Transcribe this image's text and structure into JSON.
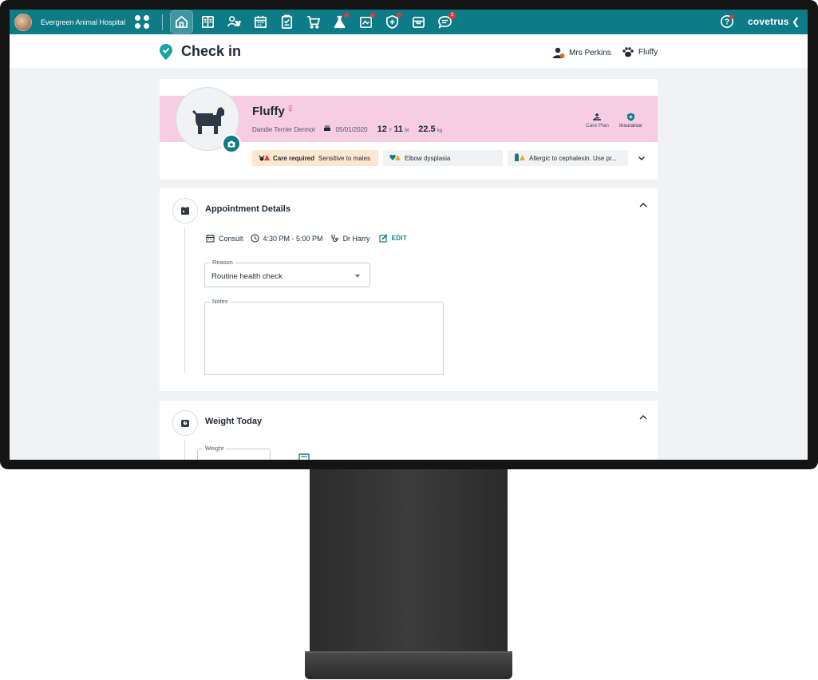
{
  "nav": {
    "hospital_name": "Evergreen Animal Hospital",
    "brand": "covetrus",
    "messages_count": "3"
  },
  "header": {
    "title": "Check in",
    "owner_name": "Mrs Perkins",
    "pet_name": "Fluffy"
  },
  "pet": {
    "name": "Fluffy",
    "sex_symbol": "♀",
    "breed": "Dandie Terrier Dermot",
    "dob": "05/01/2020",
    "age_years": "12",
    "age_years_unit": "Y",
    "age_months": "11",
    "age_months_unit": "M",
    "weight": "22.5",
    "weight_unit": "kg",
    "care_plan_label": "Care Plan",
    "insurance_label": "Insurance",
    "alerts": {
      "care_title": "Care required",
      "care_text": "Sensitive to males",
      "condition": "Elbow dysplasia",
      "allergy": "Allergic to cephalexin. Use pr..."
    }
  },
  "appointment": {
    "title": "Appointment Details",
    "type": "Consult",
    "time": "4:30 PM - 5:00 PM",
    "vet": "Dr Harry",
    "edit_label": "EDIT",
    "reason_label": "Reason",
    "reason_value": "Routine health check",
    "notes_label": "Notes",
    "notes_value": ""
  },
  "weight_section": {
    "title": "Weight Today",
    "weight_label": "Weight"
  },
  "colors": {
    "teal": "#0e7c86",
    "pink_band": "#f7cde3",
    "care_chip": "#fde7cf",
    "badge_red": "#e53935"
  }
}
